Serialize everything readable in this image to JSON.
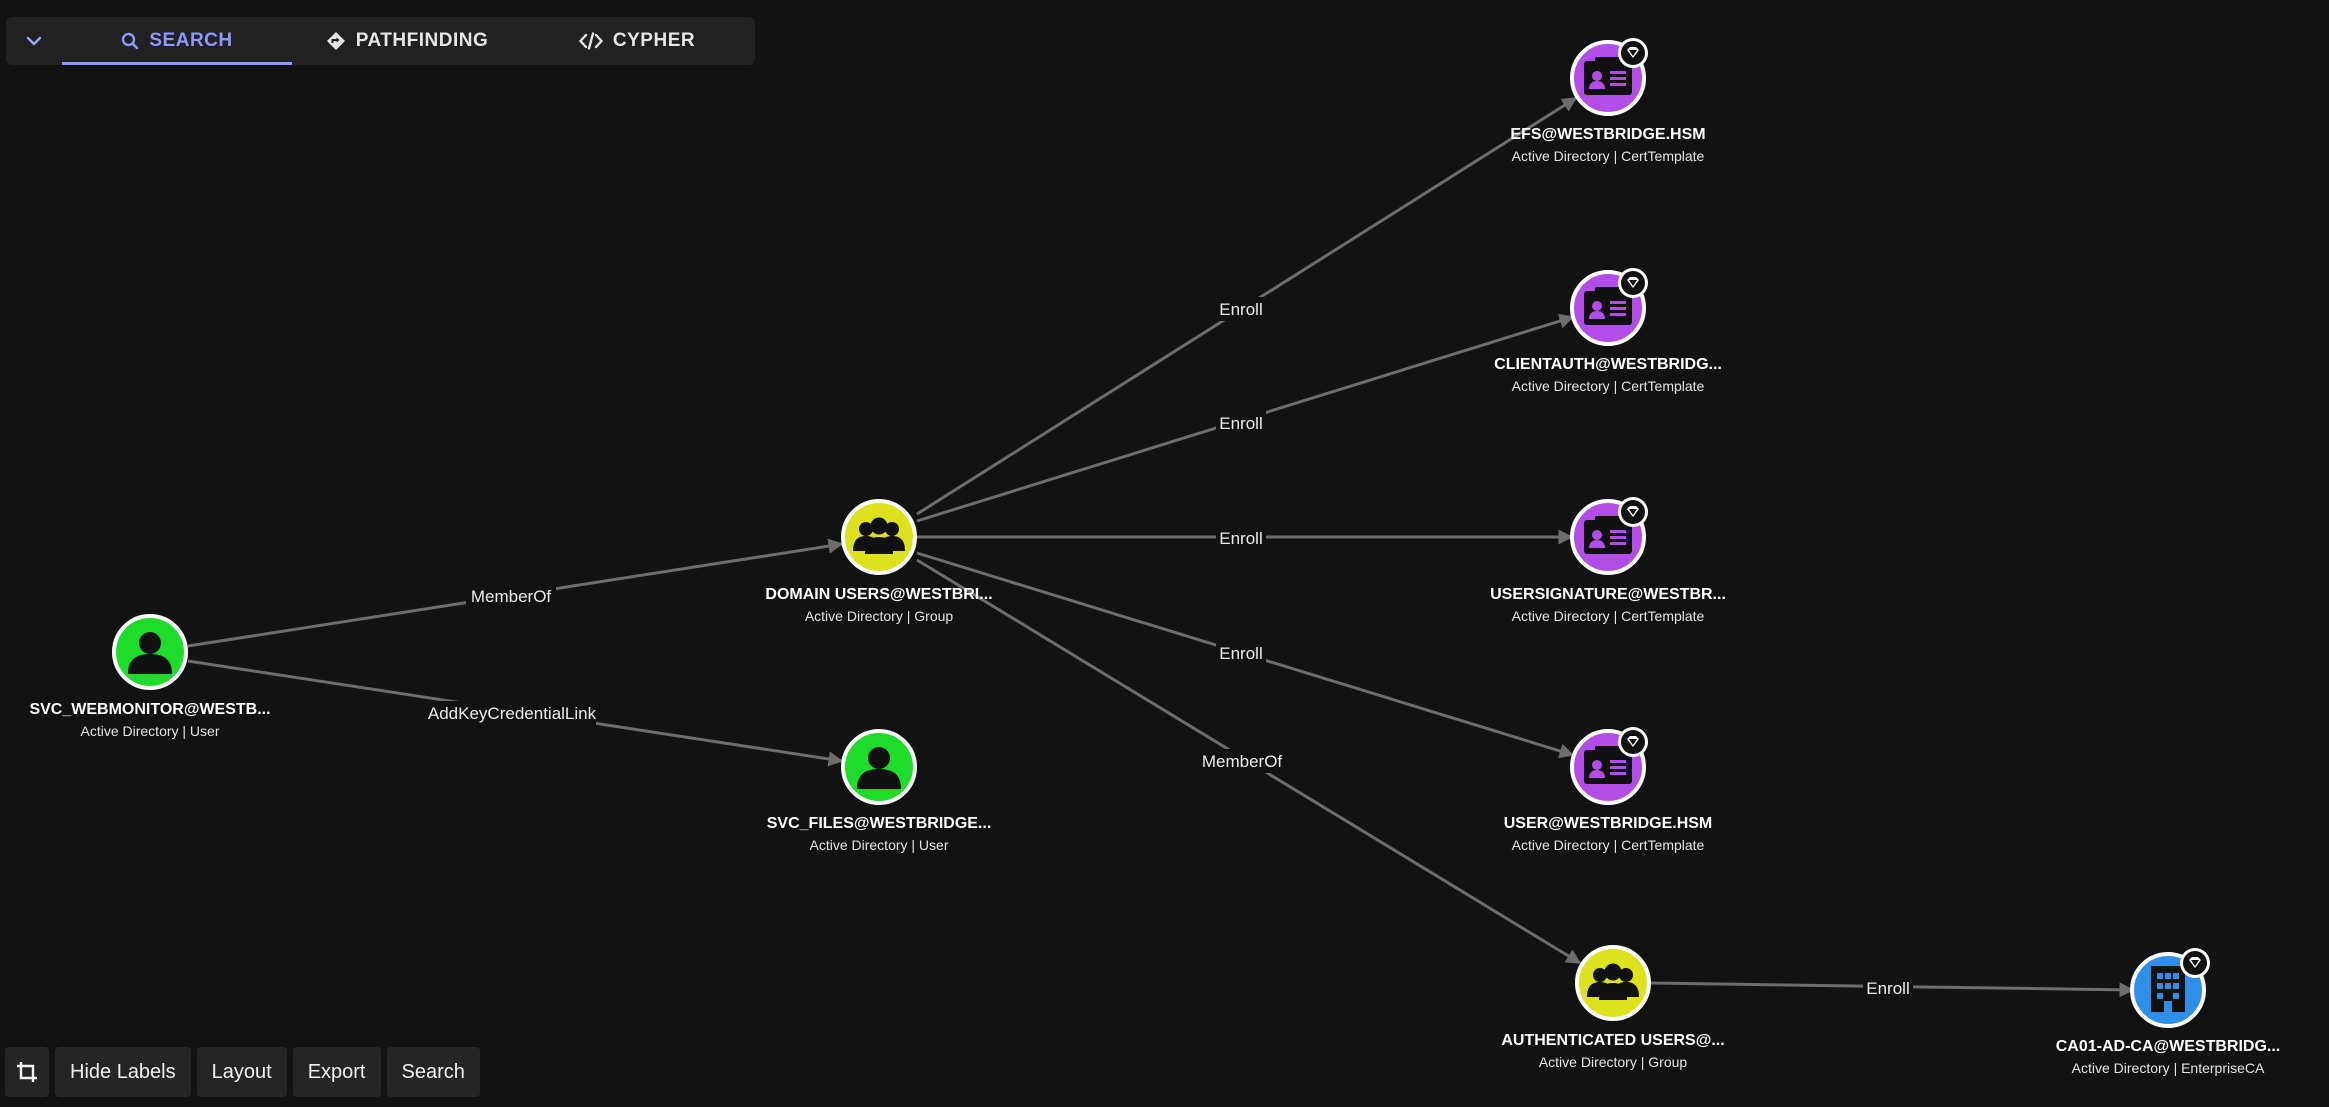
{
  "tabs": [
    {
      "label": "SEARCH",
      "icon": "search-icon",
      "active": true
    },
    {
      "label": "PATHFINDING",
      "icon": "diamond-arrow-icon",
      "active": false
    },
    {
      "label": "CYPHER",
      "icon": "code-icon",
      "active": false
    }
  ],
  "toolbar": {
    "crop_icon": "crop-icon",
    "hide_labels": "Hide Labels",
    "layout": "Layout",
    "export": "Export",
    "search": "Search"
  },
  "colors": {
    "user": "#1edc2a",
    "group": "#dde21c",
    "cert_template": "#b24de8",
    "enterprise_ca": "#2f8fe8",
    "accent": "#8d97ff"
  },
  "nodes": {
    "svc_webmonitor": {
      "name": "SVC_WEBMONITOR@WESTB...",
      "sub": "Active Directory | User",
      "kind": "user"
    },
    "domain_users": {
      "name": "DOMAIN USERS@WESTBRI...",
      "sub": "Active Directory | Group",
      "kind": "group"
    },
    "svc_files": {
      "name": "SVC_FILES@WESTBRIDGE...",
      "sub": "Active Directory | User",
      "kind": "user"
    },
    "efs": {
      "name": "EFS@WESTBRIDGE.HSM",
      "sub": "Active Directory | CertTemplate",
      "kind": "cert"
    },
    "clientauth": {
      "name": "CLIENTAUTH@WESTBRIDG...",
      "sub": "Active Directory | CertTemplate",
      "kind": "cert"
    },
    "usersignature": {
      "name": "USERSIGNATURE@WESTBR...",
      "sub": "Active Directory | CertTemplate",
      "kind": "cert"
    },
    "user": {
      "name": "USER@WESTBRIDGE.HSM",
      "sub": "Active Directory | CertTemplate",
      "kind": "cert"
    },
    "auth_users": {
      "name": "AUTHENTICATED USERS@...",
      "sub": "Active Directory | Group",
      "kind": "group"
    },
    "ca01": {
      "name": "CA01-AD-CA@WESTBRIDG...",
      "sub": "Active Directory | EnterpriseCA",
      "kind": "ca"
    }
  },
  "edges": {
    "e1": "MemberOf",
    "e2": "AddKeyCredentialLink",
    "e3": "Enroll",
    "e4": "Enroll",
    "e5": "Enroll",
    "e6": "Enroll",
    "e7": "MemberOf",
    "e8": "Enroll"
  }
}
